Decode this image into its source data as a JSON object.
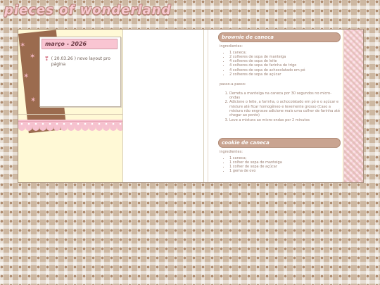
{
  "site": {
    "title": "pieces of wonderland"
  },
  "sidebar": {
    "note_title": "março - 2026",
    "entries": [
      {
        "icon": "heart-icon",
        "text": "( 20.03.26 ) novo layout pro página"
      }
    ]
  },
  "posts": [
    {
      "title": "brownie de caneca",
      "ingredients_label": "ingredientes:",
      "ingredients": [
        "1 caneca;",
        "2 colheres de sopa de manteiga",
        "4 colheres de sopa de leite",
        "4 colheres de sopa de farinha de trigo",
        "4 colheres de sopa de achocolatado em pó",
        "2 colheres de sopa de açúcar"
      ],
      "steps_label": "passo-a-passo:",
      "steps": [
        "Derreta a manteiga na caneca por 30 segundos no micro-ondas",
        "Adicione o leite, a farinha, o achocolatado em pó e o açúcar e misture até ficar homogêneo e levemente grosso (Caso a mistura não engrosse adicione mais uma colher de farinha até chegar ao ponto)",
        "Leve a mistura ao micro-ondas por 2 minutos"
      ]
    },
    {
      "title": "cookie de caneca",
      "ingredients_label": "ingredientes:",
      "ingredients": [
        "1 caneca;",
        "1 colher de sopa de manteiga",
        "1 colher de sopa de açúcar",
        "1 gema de ovo"
      ]
    }
  ],
  "colors": {
    "accent_pink": "#f9c5d2",
    "brown": "#9b6b4e",
    "post_header": "#c9a491"
  }
}
